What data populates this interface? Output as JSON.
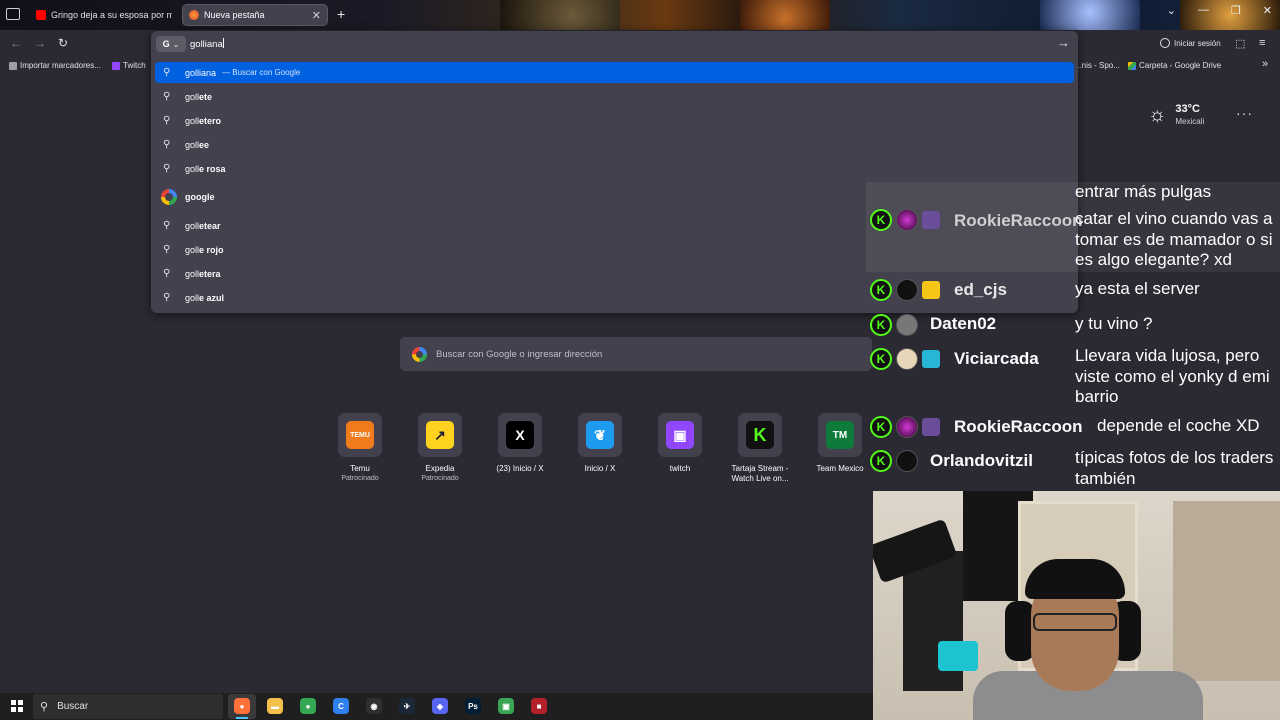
{
  "browser": {
    "tabs": [
      {
        "title": "Gringo deja a su esposa por más",
        "favicon_color": "#ff0000",
        "active": false
      },
      {
        "title": "Nueva pestaña",
        "favicon_color": "#d94a22",
        "active": true
      }
    ],
    "new_tab_symbol": "+",
    "window_controls": [
      "⌄",
      "—",
      "❐",
      "✕"
    ],
    "signin_label": "Iniciar sesión",
    "menu_symbol": "≡"
  },
  "bookmarks": {
    "items": [
      {
        "label": "Importar marcadores...",
        "color": "#9e9ea8"
      },
      {
        "label": "Twitch",
        "color": "#9146ff"
      },
      {
        "label": "...nis - Spo...",
        "color": "#1db954"
      },
      {
        "label": "Carpeta - Google Drive",
        "color": "#fbbc05"
      }
    ],
    "overflow": "»"
  },
  "urlbar": {
    "engine_letter": "G",
    "value": "golliana",
    "suggestions": [
      {
        "prefix": "golliana",
        "bold": "",
        "sub": "— Buscar con Google",
        "selected": true,
        "type": "search"
      },
      {
        "prefix": "goll",
        "bold": "ete",
        "sub": "",
        "type": "search"
      },
      {
        "prefix": "goll",
        "bold": "etero",
        "sub": "",
        "type": "search"
      },
      {
        "prefix": "goll",
        "bold": "ee",
        "sub": "",
        "type": "search"
      },
      {
        "prefix": "goll",
        "bold": "e rosa",
        "sub": "",
        "type": "search"
      },
      {
        "prefix": "",
        "bold": "google",
        "sub": "",
        "type": "site"
      },
      {
        "prefix": "goll",
        "bold": "etear",
        "sub": "",
        "type": "search"
      },
      {
        "prefix": "goll",
        "bold": "e rojo",
        "sub": "",
        "type": "search"
      },
      {
        "prefix": "goll",
        "bold": "etera",
        "sub": "",
        "type": "search"
      },
      {
        "prefix": "goll",
        "bold": "e azul",
        "sub": "",
        "type": "search"
      }
    ]
  },
  "newtab": {
    "weather": {
      "temp": "33°C",
      "city": "Mexicali",
      "icon": "sun-icon"
    },
    "search_placeholder": "Buscar con Google o ingresar dirección",
    "tiles": [
      {
        "label": "Temu",
        "sub": "Patrocinado",
        "icon_text": "TEMU",
        "bg": "#f07b1d",
        "fg": "#ffffff"
      },
      {
        "label": "Expedia",
        "sub": "Patrocinado",
        "icon_text": "↗",
        "bg": "#ffd21f",
        "fg": "#191e3b"
      },
      {
        "label": "(23) Inicio / X",
        "sub": "",
        "icon_text": "X",
        "bg": "#000000",
        "fg": "#ffffff"
      },
      {
        "label": "Inicio / X",
        "sub": "",
        "icon_text": "❦",
        "bg": "#1d9bf0",
        "fg": "#ffffff"
      },
      {
        "label": "twitch",
        "sub": "",
        "icon_text": "▣",
        "bg": "#9146ff",
        "fg": "#ffffff"
      },
      {
        "label": "Tartaja Stream - Watch Live on...",
        "sub": "",
        "icon_text": "K",
        "bg": "#111111",
        "fg": "#53fc18"
      },
      {
        "label": "Team Mexico",
        "sub": "",
        "icon_text": "TM",
        "bg": "#0e7a3c",
        "fg": "#ffffff"
      }
    ]
  },
  "chat": [
    {
      "user": "",
      "message": "entrar más pulgas",
      "user_color": "#ffffff"
    },
    {
      "user": "RookieRaccoon",
      "message": "catar el vino cuando vas a tomar es de mamador o si es algo elegante? xd",
      "user_color": "#d9d9d9"
    },
    {
      "user": "ed_cjs",
      "message": "ya esta el server",
      "user_color": "#e8e8e8"
    },
    {
      "user": "Daten02",
      "message": "y tu vino ?",
      "user_color": "#ffffff"
    },
    {
      "user": "Viciarcada",
      "message": "Llevara vida lujosa, pero viste como el yonky d emi barrio",
      "user_color": "#ffffff"
    },
    {
      "user": "RookieRaccoon",
      "message": "depende el coche XD",
      "user_color": "#ffffff"
    },
    {
      "user": "Orlandovitzil",
      "message": "típicas fotos de los traders también",
      "user_color": "#ffffff"
    }
  ],
  "taskbar": {
    "search_label": "Buscar",
    "apps": [
      {
        "name": "firefox",
        "color": "#ff7139",
        "glyph": "●",
        "active": true
      },
      {
        "name": "explorer",
        "color": "#f3c04c",
        "glyph": "▬"
      },
      {
        "name": "chrome",
        "color": "#34a853",
        "glyph": "●"
      },
      {
        "name": "ccleaner",
        "color": "#2f80ed",
        "glyph": "C"
      },
      {
        "name": "obs",
        "color": "#302e31",
        "glyph": "◉"
      },
      {
        "name": "steam",
        "color": "#1b2838",
        "glyph": "✈"
      },
      {
        "name": "discord-like",
        "color": "#5865f2",
        "glyph": "◈"
      },
      {
        "name": "photoshop",
        "color": "#001e36",
        "glyph": "Ps"
      },
      {
        "name": "app-green",
        "color": "#3aa655",
        "glyph": "▣"
      },
      {
        "name": "app-red",
        "color": "#b3202a",
        "glyph": "■"
      }
    ]
  }
}
